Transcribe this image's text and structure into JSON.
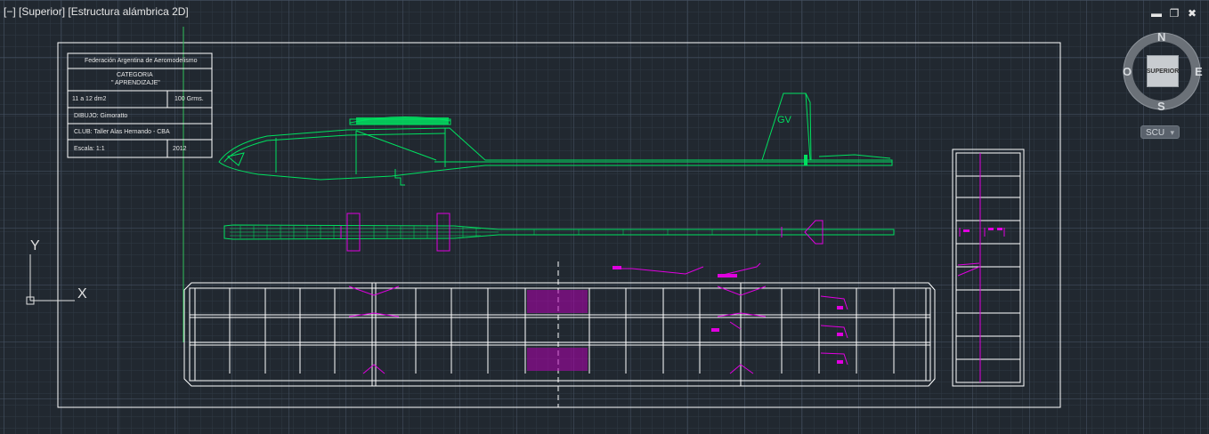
{
  "viewport": {
    "label": "[−] [Superior] [Estructura alámbrica 2D]"
  },
  "window_controls": {
    "minimize": "▬",
    "restore": "❐",
    "close": "✖"
  },
  "viewcube": {
    "north": "N",
    "south": "S",
    "east": "E",
    "west": "O",
    "face": "SUPERIOR",
    "ucs_menu": "SCU"
  },
  "ucs_icon": {
    "x_label": "X",
    "y_label": "Y"
  },
  "title_block": {
    "federation": "Federación Argentina de Aeromodelismo",
    "category_label": "CATEGORIA",
    "category_value": "\" APRENDIZAJE\"",
    "area": "11 a 12 dm2",
    "weight": "100 Grms.",
    "drawn_by": "DIBUJO: Gimoratto",
    "club": "CLUB: Taller Alas Hernando - CBA",
    "scale": "Escala: 1:1",
    "year": "2012"
  },
  "drawing": {
    "fin_marking": "GV"
  },
  "colors": {
    "background": "#212830",
    "green": "#00e060",
    "magenta": "#e000e0",
    "white": "#ffffff"
  }
}
